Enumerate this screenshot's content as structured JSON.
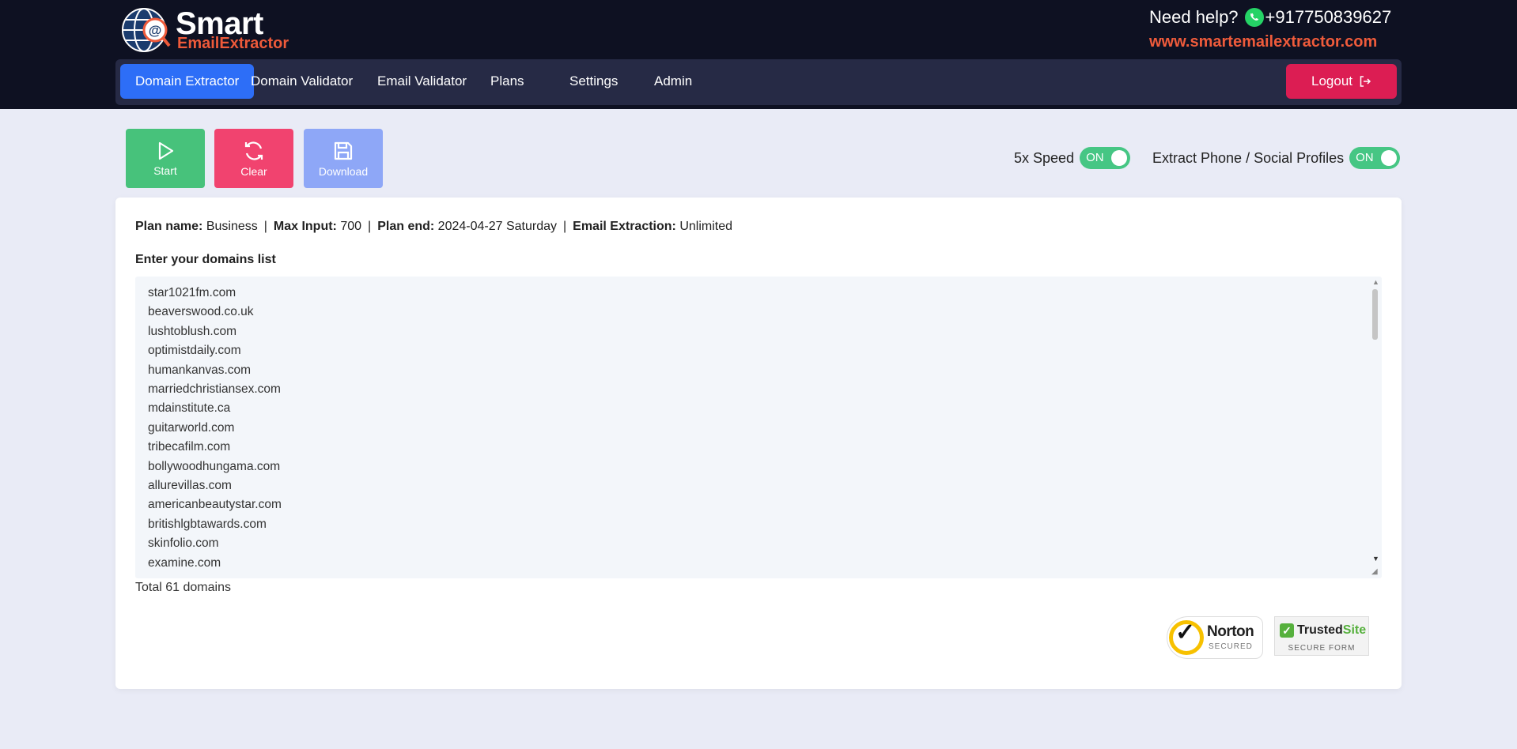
{
  "header": {
    "logo_line1": "Smart",
    "logo_line2": "EmailExtractor",
    "help_label": "Need help?",
    "phone": "+917750839627",
    "website": "www.smartemailextractor.com"
  },
  "nav": {
    "items": [
      {
        "label": "Domain Extractor",
        "active": true
      },
      {
        "label": "Domain Validator",
        "active": false
      },
      {
        "label": "Email Validator",
        "active": false
      },
      {
        "label": "Plans",
        "active": false
      },
      {
        "label": "Settings",
        "active": false
      },
      {
        "label": "Admin",
        "active": false
      }
    ],
    "logout_label": "Logout"
  },
  "actions": {
    "start_label": "Start",
    "clear_label": "Clear",
    "download_label": "Download"
  },
  "toggles": {
    "speed_label": "5x Speed",
    "speed_state": "ON",
    "phone_label": "Extract Phone / Social Profiles",
    "phone_state": "ON"
  },
  "plan": {
    "name_label": "Plan name:",
    "name_value": "Business",
    "max_label": "Max Input:",
    "max_value": "700",
    "end_label": "Plan end:",
    "end_value": "2024-04-27 Saturday",
    "email_label": "Email Extraction:",
    "email_value": "Unlimited"
  },
  "domains": {
    "label": "Enter your domains list",
    "list": [
      "star1021fm.com",
      "beaverswood.co.uk",
      "lushtoblush.com",
      "optimistdaily.com",
      "humankanvas.com",
      "marriedchristiansex.com",
      "mdainstitute.ca",
      "guitarworld.com",
      "tribecafilm.com",
      "bollywoodhungama.com",
      "allurevillas.com",
      "americanbeautystar.com",
      "britishlgbtawards.com",
      "skinfolio.com",
      "examine.com"
    ],
    "total": "Total 61 domains"
  },
  "badges": {
    "norton_name": "Norton",
    "norton_sub": "SECURED",
    "trusted_name_1": "Trusted",
    "trusted_name_2": "Site",
    "trusted_sub": "SECURE FORM"
  }
}
